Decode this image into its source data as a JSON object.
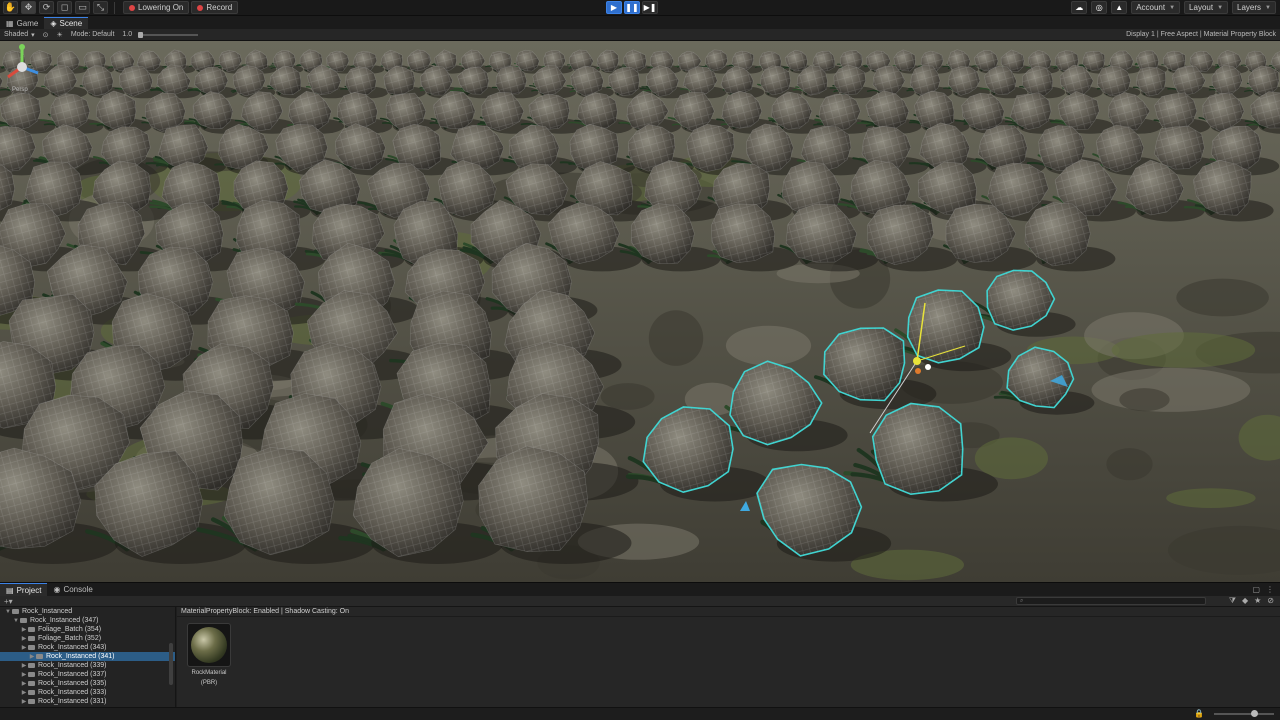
{
  "toolbar": {
    "tools": [
      "hand-tool-icon",
      "move-tool-icon",
      "rotate-tool-icon",
      "scale-tool-icon",
      "rect-tool-icon",
      "transform-tool-icon"
    ],
    "record_label": "Lowering On",
    "record_button": "Record",
    "right": {
      "collab_icon": "cloud-icon",
      "account_label": "Account",
      "layout_label": "Layout",
      "layers_label": "Layers"
    }
  },
  "tabs": {
    "game": "Game",
    "scene": "Scene"
  },
  "scene_bar": {
    "shading": "Shaded",
    "mode_label": "Mode: Default",
    "scale_label": "1.0",
    "right_label": "Display 1 | Free Aspect | Material Property Block"
  },
  "project": {
    "tab_project": "Project",
    "tab_console": "Console",
    "search_placeholder": "",
    "tree": [
      {
        "label": "Rock_Instanced",
        "depth": 0,
        "expanded": true,
        "selected": false
      },
      {
        "label": "Rock_Instanced (347)",
        "depth": 1,
        "expanded": true,
        "selected": false
      },
      {
        "label": "Foliage_Batch (354)",
        "depth": 2,
        "expanded": false,
        "selected": false
      },
      {
        "label": "Foliage_Batch (352)",
        "depth": 2,
        "expanded": false,
        "selected": false
      },
      {
        "label": "Rock_Instanced (343)",
        "depth": 2,
        "expanded": false,
        "selected": false
      },
      {
        "label": "Rock_Instanced (341)",
        "depth": 3,
        "expanded": false,
        "selected": true
      },
      {
        "label": "Rock_Instanced (339)",
        "depth": 2,
        "expanded": false,
        "selected": false
      },
      {
        "label": "Rock_Instanced (337)",
        "depth": 2,
        "expanded": false,
        "selected": false
      },
      {
        "label": "Rock_Instanced (335)",
        "depth": 2,
        "expanded": false,
        "selected": false
      },
      {
        "label": "Rock_Instanced (333)",
        "depth": 2,
        "expanded": false,
        "selected": false
      },
      {
        "label": "Rock_Instanced (331)",
        "depth": 2,
        "expanded": false,
        "selected": false
      }
    ],
    "info_line": "MaterialPropertyBlock: Enabled | Shadow Casting: On",
    "asset": {
      "name": "RockMaterial",
      "sub": "(PBR)"
    }
  },
  "colors": {
    "accent": "#2f6fce",
    "selection": "#2c5d87",
    "wireframe": "#3fd3d0"
  }
}
